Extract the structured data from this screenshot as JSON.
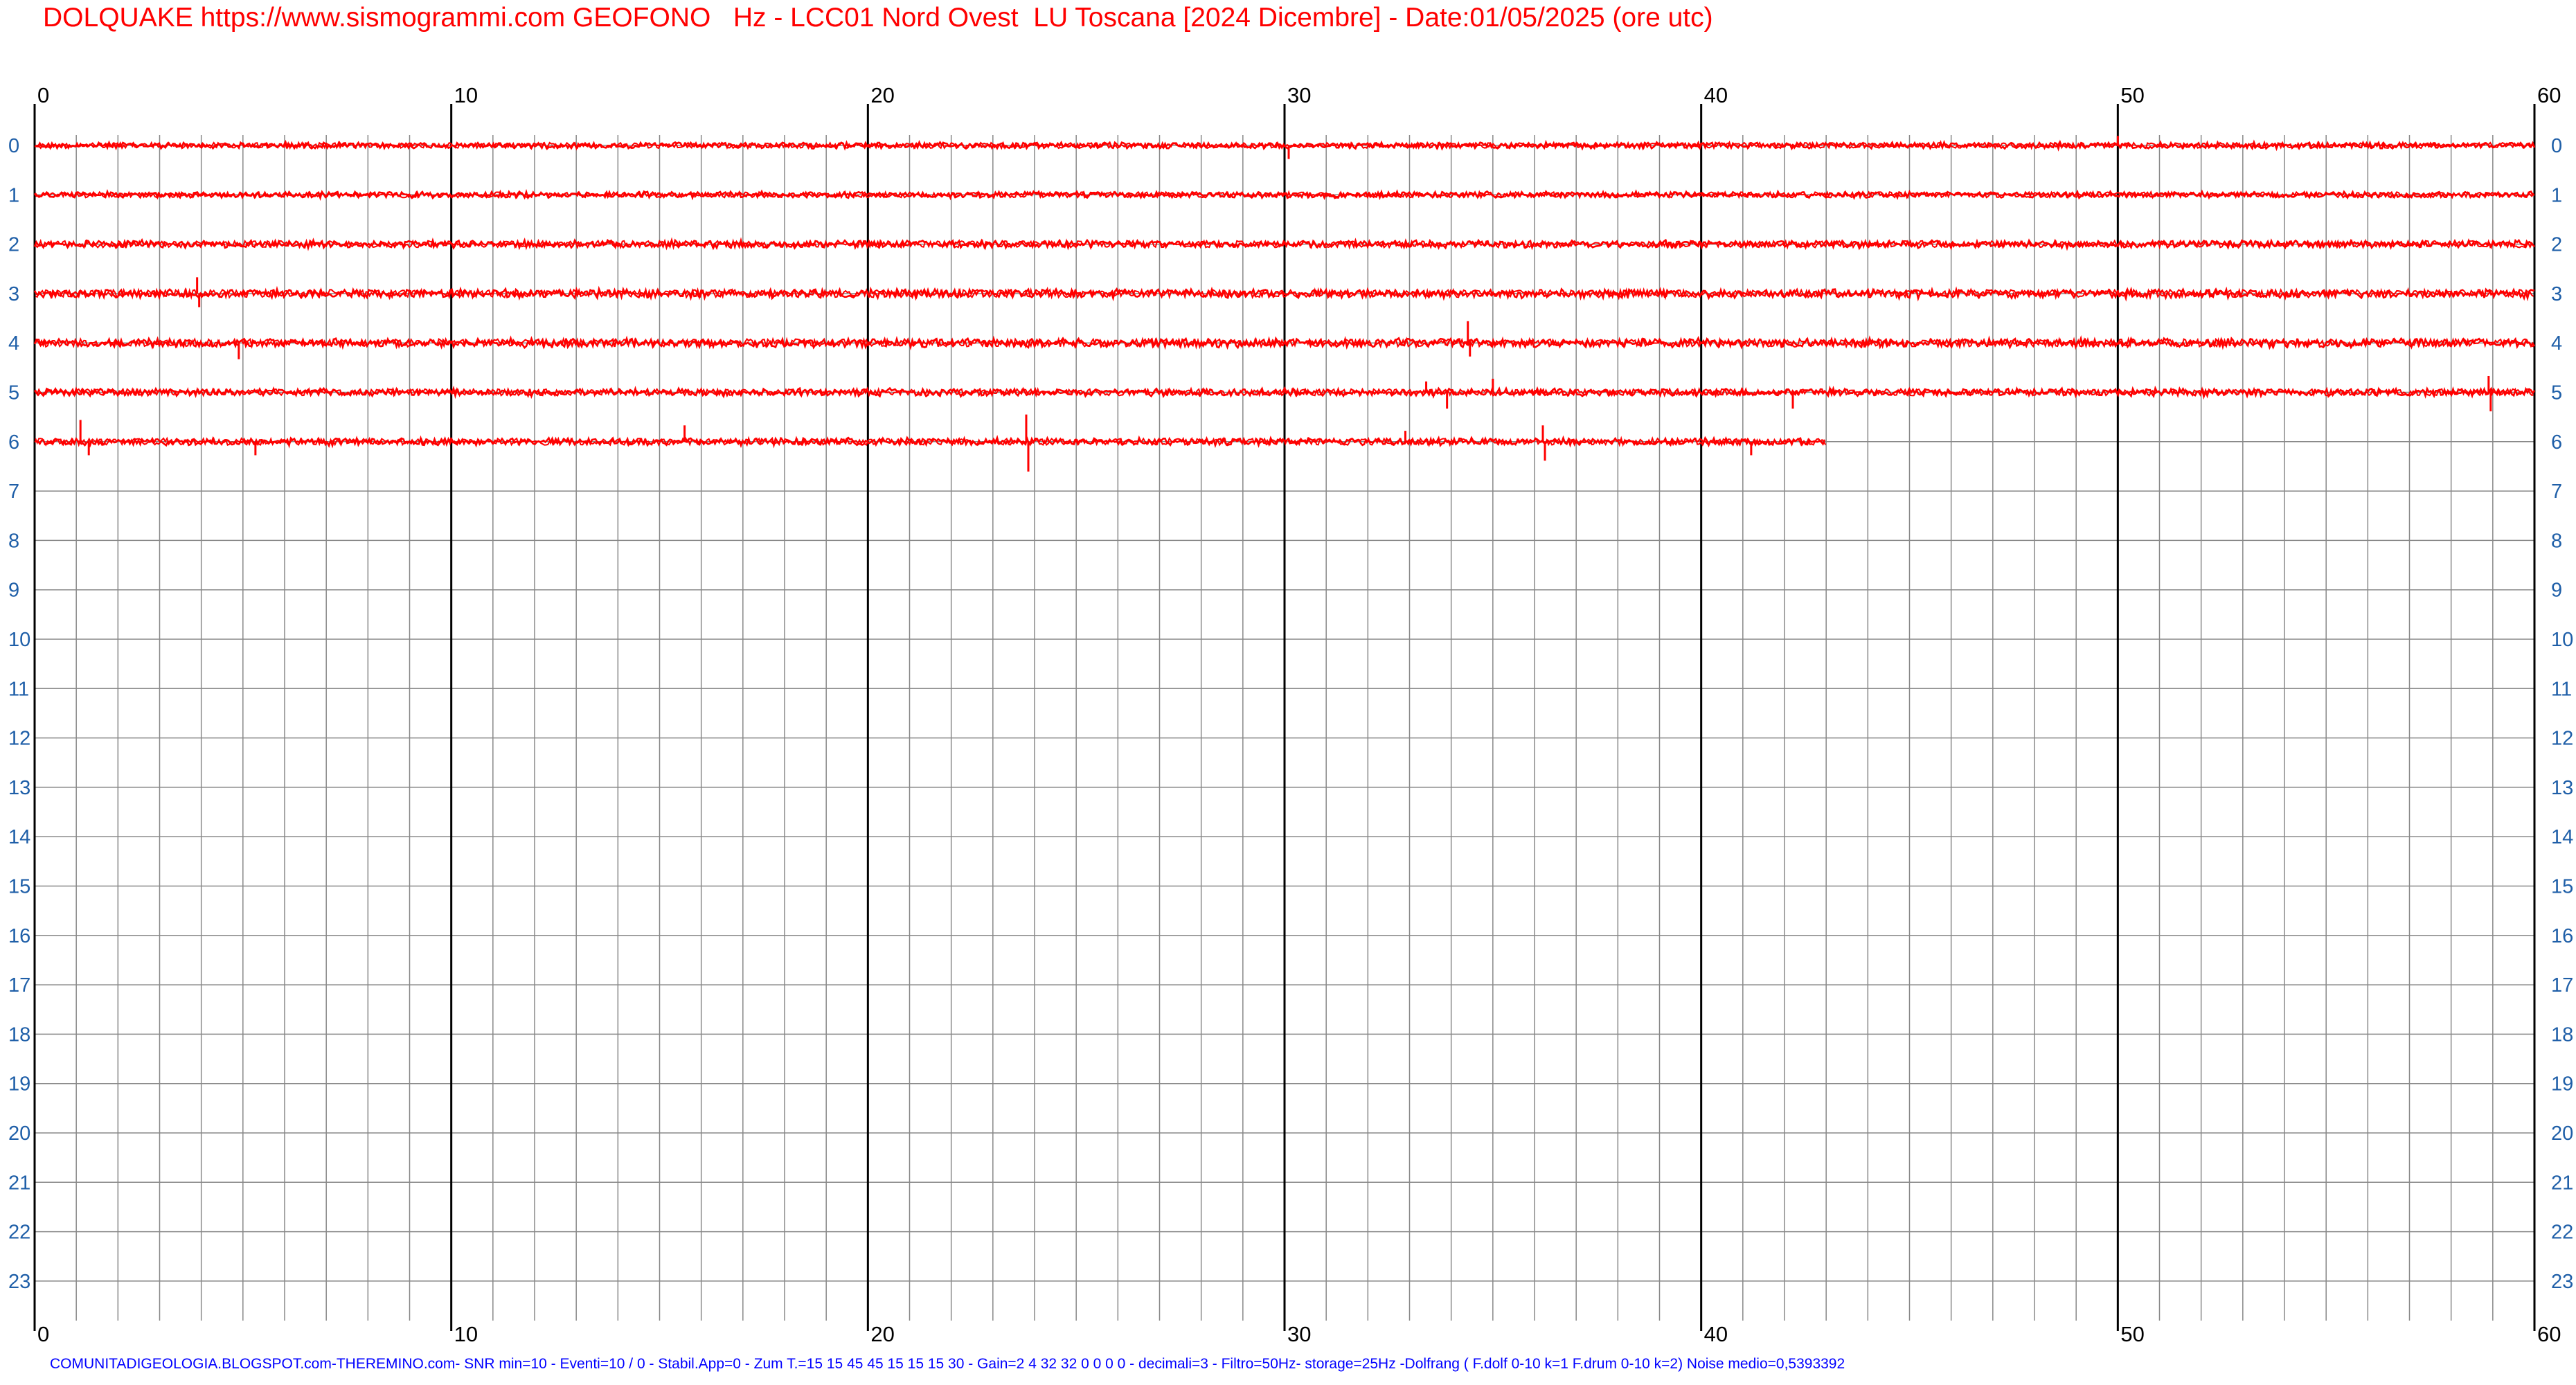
{
  "header": {
    "title": "DOLQUAKE https://www.sismogrammi.com GEOFONO   Hz - LCC01 Nord Ovest  LU Toscana [2024 Dicembre] - Date:01/05/2025 (ore utc)"
  },
  "footer": {
    "text": "COMUNITADIGEOLOGIA.BLOGSPOT.com-THEREMINO.com- SNR min=10 - Eventi=10 / 0 - Stabil.App=0 - Zum T.=15 15 45 45 15 15 15 30 - Gain=2 4 32 32 0 0 0 0 - decimali=3 - Filtro=50Hz- storage=25Hz -Dolfrang ( F.dolf 0-10 k=1 F.drum 0-10 k=2) Noise medio=0,5393392"
  },
  "colors": {
    "title": "#ff0000",
    "trace": "#ff0000",
    "footer": "#0000ff",
    "row_labels": "#1f5fa8",
    "grid_minor": "#888888",
    "grid_major": "#000000"
  },
  "chart_data": {
    "type": "line",
    "title": "DOLQUAKE https://www.sismogrammi.com GEOFONO   Hz - LCC01 Nord Ovest  LU Toscana [2024 Dicembre] - Date:01/05/2025 (ore utc)",
    "xlabel": "",
    "ylabel": "",
    "x_ticks": [
      "0",
      "10",
      "20",
      "30",
      "40",
      "50",
      "60"
    ],
    "x_range": [
      0,
      60
    ],
    "minor_grid_step_minutes": 1,
    "y_hours": [
      "0",
      "1",
      "2",
      "3",
      "4",
      "5",
      "6",
      "7",
      "8",
      "9",
      "10",
      "11",
      "12",
      "13",
      "14",
      "15",
      "16",
      "17",
      "18",
      "19",
      "20",
      "21",
      "22",
      "23"
    ],
    "grid": true,
    "series": [
      {
        "hour": 0,
        "end_minute": 60,
        "noise_amplitude": 0.25,
        "spikes": [
          {
            "minute": 30.1,
            "amplitude": -0.5
          },
          {
            "minute": 50.0,
            "amplitude": 0.35
          }
        ]
      },
      {
        "hour": 1,
        "end_minute": 60,
        "noise_amplitude": 0.25,
        "spikes": []
      },
      {
        "hour": 2,
        "end_minute": 60,
        "noise_amplitude": 0.3,
        "spikes": []
      },
      {
        "hour": 3,
        "end_minute": 60,
        "noise_amplitude": 0.35,
        "spikes": [
          {
            "minute": 3.9,
            "amplitude": 0.6
          },
          {
            "minute": 3.95,
            "amplitude": -0.5
          }
        ]
      },
      {
        "hour": 4,
        "end_minute": 60,
        "noise_amplitude": 0.35,
        "spikes": [
          {
            "minute": 4.9,
            "amplitude": -0.6
          },
          {
            "minute": 34.4,
            "amplitude": 0.8
          },
          {
            "minute": 34.45,
            "amplitude": -0.5
          }
        ]
      },
      {
        "hour": 5,
        "end_minute": 60,
        "noise_amplitude": 0.3,
        "spikes": [
          {
            "minute": 33.4,
            "amplitude": 0.4
          },
          {
            "minute": 33.9,
            "amplitude": -0.6
          },
          {
            "minute": 35.0,
            "amplitude": 0.5
          },
          {
            "minute": 42.2,
            "amplitude": -0.6
          },
          {
            "minute": 58.9,
            "amplitude": 0.6
          },
          {
            "minute": 58.95,
            "amplitude": -0.7
          }
        ]
      },
      {
        "hour": 6,
        "end_minute": 43,
        "noise_amplitude": 0.3,
        "spikes": [
          {
            "minute": 1.1,
            "amplitude": 0.8
          },
          {
            "minute": 1.3,
            "amplitude": -0.5
          },
          {
            "minute": 5.3,
            "amplitude": -0.5
          },
          {
            "minute": 15.6,
            "amplitude": 0.6
          },
          {
            "minute": 23.8,
            "amplitude": 1.0
          },
          {
            "minute": 23.85,
            "amplitude": -1.1
          },
          {
            "minute": 32.9,
            "amplitude": 0.4
          },
          {
            "minute": 36.2,
            "amplitude": 0.6
          },
          {
            "minute": 36.25,
            "amplitude": -0.7
          },
          {
            "minute": 41.2,
            "amplitude": -0.5
          }
        ]
      }
    ]
  }
}
